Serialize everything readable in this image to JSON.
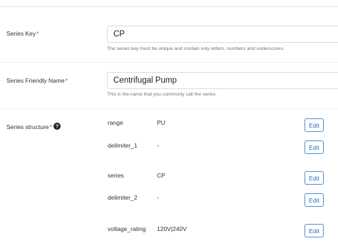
{
  "series_key": {
    "label": "Series Key",
    "required_mark": "*",
    "value": "CP",
    "help": "The series key must be unique and contain only letters, numbers and underscores."
  },
  "friendly_name": {
    "label": "Series Friendly Name",
    "required_mark": "*",
    "value": "Centrifugal Pump",
    "help": "This is the name that you commonly call the series."
  },
  "structure": {
    "label": "Series structure",
    "required_mark": "*",
    "help_icon": "question-circle-icon",
    "edit_label": "Edit",
    "rows": [
      {
        "key": "range",
        "value": "PU"
      },
      {
        "key": "delimiter_1",
        "value": "-"
      },
      {
        "key": "series",
        "value": "CP"
      },
      {
        "key": "delimiter_2",
        "value": "-"
      },
      {
        "key": "voltage_rating",
        "value": "120V|240V"
      }
    ]
  },
  "colors": {
    "required": "#e53935",
    "edit_border": "#4a90d9",
    "edit_text": "#2f6fb5"
  }
}
